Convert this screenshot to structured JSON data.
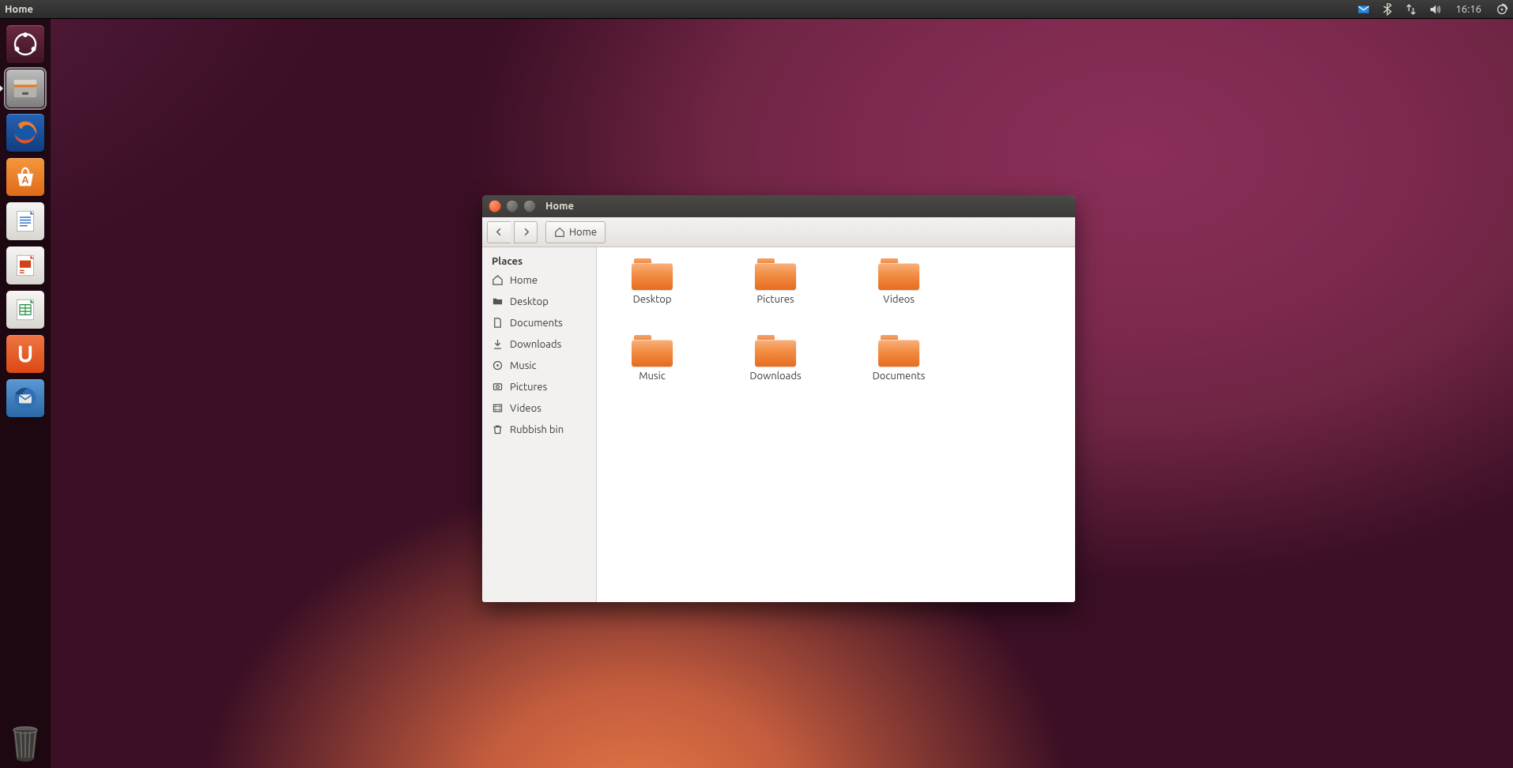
{
  "top_panel": {
    "app_label": "Home",
    "clock": "16:16"
  },
  "launcher": {
    "items": [
      {
        "id": "dash",
        "name": "dash-icon"
      },
      {
        "id": "files",
        "name": "file-manager-icon",
        "active": true,
        "running": true
      },
      {
        "id": "firefox",
        "name": "firefox-icon"
      },
      {
        "id": "software-center",
        "name": "software-center-icon"
      },
      {
        "id": "writer",
        "name": "libreoffice-writer-icon"
      },
      {
        "id": "impress",
        "name": "libreoffice-impress-icon"
      },
      {
        "id": "calc",
        "name": "libreoffice-calc-icon"
      },
      {
        "id": "ubuntuone",
        "name": "ubuntu-one-icon"
      },
      {
        "id": "thunderbird",
        "name": "thunderbird-icon"
      }
    ],
    "trash": {
      "name": "trash-icon"
    }
  },
  "window": {
    "title": "Home",
    "breadcrumb": "Home",
    "sidebar": {
      "section": "Places",
      "places": [
        {
          "icon": "home",
          "label": "Home"
        },
        {
          "icon": "desktop",
          "label": "Desktop"
        },
        {
          "icon": "documents",
          "label": "Documents"
        },
        {
          "icon": "downloads",
          "label": "Downloads"
        },
        {
          "icon": "music",
          "label": "Music"
        },
        {
          "icon": "pictures",
          "label": "Pictures"
        },
        {
          "icon": "videos",
          "label": "Videos"
        },
        {
          "icon": "trash",
          "label": "Rubbish bin"
        }
      ]
    },
    "folders": [
      {
        "label": "Desktop"
      },
      {
        "label": "Pictures"
      },
      {
        "label": "Videos"
      },
      {
        "label": "Music"
      },
      {
        "label": "Downloads"
      },
      {
        "label": "Documents"
      }
    ]
  }
}
